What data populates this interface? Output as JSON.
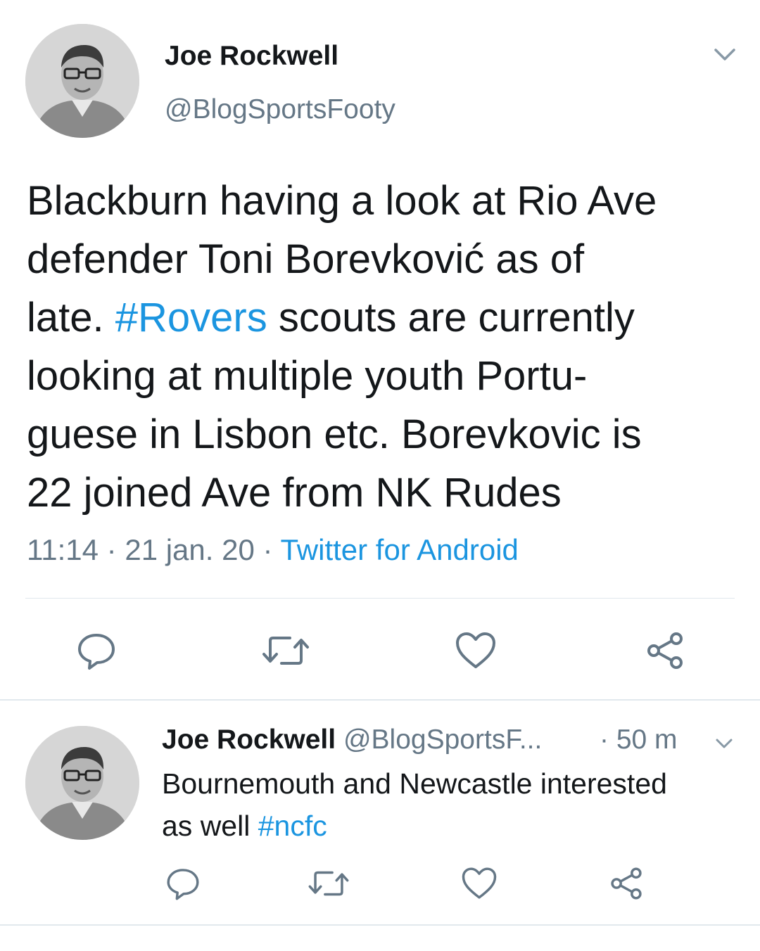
{
  "colors": {
    "text": "#14171a",
    "muted": "#657786",
    "link": "#1b95e0",
    "divider": "#e1e8ed"
  },
  "main_tweet": {
    "author_name": "Joe Rockwell",
    "author_handle": "@BlogSportsFooty",
    "text_lines": [
      {
        "before": "Blackburn having a look at Rio Ave",
        "hashtag": "",
        "after": ""
      },
      {
        "before": "defender Toni Borevković as of",
        "hashtag": "",
        "after": ""
      },
      {
        "before": "late. ",
        "hashtag": "#Rovers",
        "after": " scouts are currently"
      },
      {
        "before": "looking at multiple youth Portu-",
        "hashtag": "",
        "after": ""
      },
      {
        "before": "guese in Lisbon etc. Borevkovic is",
        "hashtag": "",
        "after": ""
      },
      {
        "before": "22 joined Ave from NK Rudes",
        "hashtag": "",
        "after": ""
      }
    ],
    "time": "11:14",
    "date": "21 jan. 20",
    "separator": "·",
    "source": "Twitter for Android",
    "icons": {
      "menu": "chevron-down-icon",
      "reply": "reply-icon",
      "retweet": "retweet-icon",
      "like": "heart-icon",
      "share": "share-icon"
    }
  },
  "reply_tweet": {
    "author_name": "Joe Rockwell",
    "author_handle": "@BlogSportsF...",
    "time": "· 50 m",
    "text_line1": "Bournemouth and Newcastle interested",
    "text_line2_before": "as well ",
    "hashtag": "#ncfc"
  }
}
